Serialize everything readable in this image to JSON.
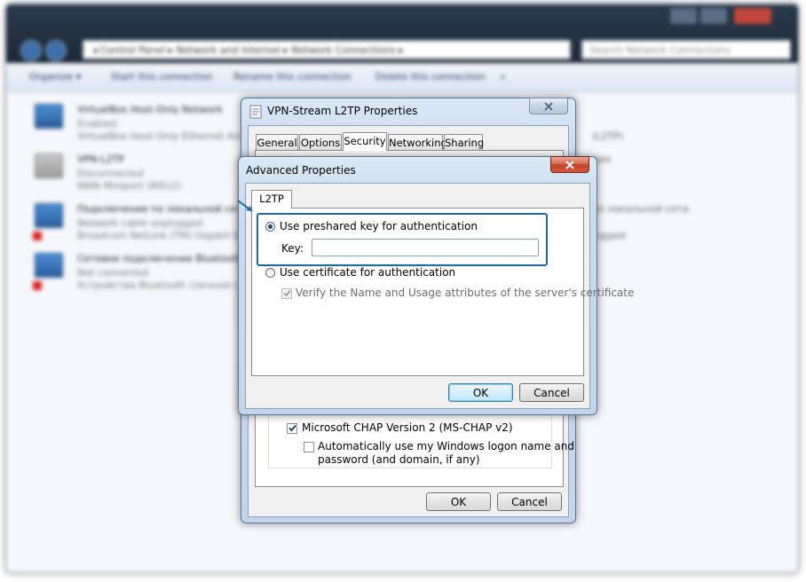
{
  "explorer": {
    "address": "◂ Control Panel ▸ Network and Internet ▸ Network Connections ▸",
    "search_placeholder": "Search Network Connections",
    "toolbar": {
      "organize": "Organize ▾",
      "start": "Start this connection",
      "rename": "Rename this connection",
      "delete": "Delete this connection",
      "more": "»"
    },
    "connections": [
      {
        "name": "VirtualBox Host-Only Network",
        "status": "Enabled",
        "device": "VirtualBox Host-Only Ethernet Ad..."
      },
      {
        "name": "VPN-L2TP",
        "status": "Disconnected",
        "device": "WAN Miniport (IKEv2)"
      },
      {
        "name": "Подключение по локальной сети",
        "status": "Network cable unplugged",
        "device": "Broadcom NetLink (TM) Gigabit E..."
      },
      {
        "name": "Сетевое подключение Bluetooth",
        "status": "Not connected",
        "device": "Устройства Bluetooth (личной с..."
      }
    ],
    "right_column": [
      "(L2TP)",
      "ния",
      "по локальной сети",
      "lugged"
    ]
  },
  "properties": {
    "title": "VPN-Stream L2TP Properties",
    "tabs": [
      "General",
      "Options",
      "Security",
      "Networking",
      "Sharing"
    ],
    "active_tab": "Security",
    "mschap_label": "Microsoft CHAP Version 2 (MS-CHAP v2)",
    "mschap_checked": true,
    "auto_logon_label_1": "Automatically use my Windows logon name and",
    "auto_logon_label_2": "password (and domain, if any)",
    "auto_logon_checked": false,
    "ok": "OK",
    "cancel": "Cancel"
  },
  "advanced": {
    "title": "Advanced Properties",
    "tab": "L2TP",
    "psk_option": "Use preshared key for authentication",
    "psk_selected": true,
    "key_label": "Key:",
    "key_value": "",
    "cert_option": "Use certificate for authentication",
    "verify_label": "Verify the Name and Usage attributes of the server's certificate",
    "verify_checked": true,
    "ok": "OK",
    "cancel": "Cancel"
  },
  "colors": {
    "highlight": "#1f6a9c",
    "accent": "#3c7fb1"
  }
}
